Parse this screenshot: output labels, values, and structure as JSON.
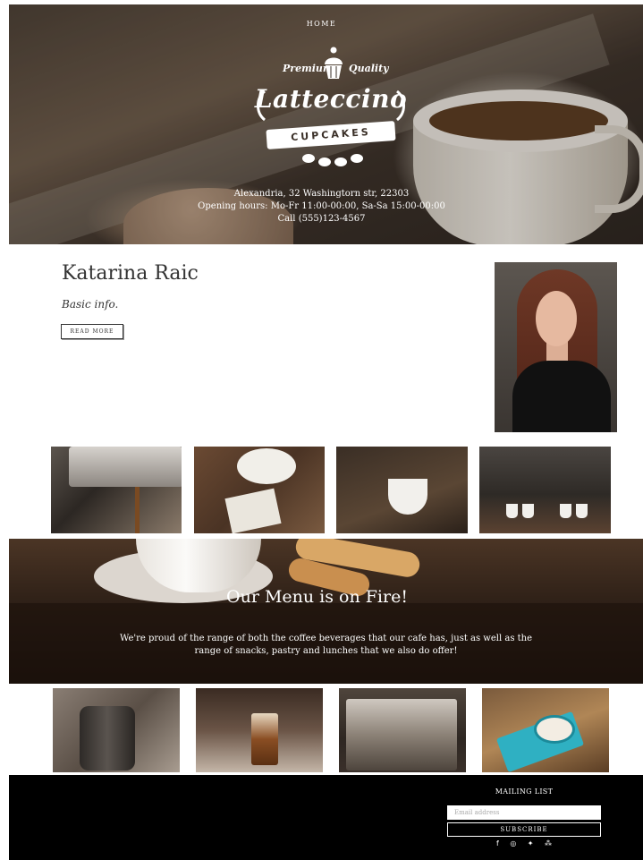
{
  "nav": {
    "home_label": "HOME"
  },
  "logo": {
    "premium_left": "Premium",
    "premium_right": "Quality",
    "brand": "Latteccino",
    "ribbon": "CUPCAKES"
  },
  "hero": {
    "address": "Alexandria, 32 Washingtorn str, 22303",
    "hours": "Opening hours: Mo-Fr 11:00-00:00, Sa-Sa 15:00-00:00",
    "phone": "Call (555)123-4567"
  },
  "profile": {
    "name": "Katarina Raic",
    "subtitle": "Basic info.",
    "read_more": "READ MORE"
  },
  "menu": {
    "title": "Our Menu is on Fire!",
    "description": "We're proud of the range of both the coffee beverages that our cafe has, just as well as the range of snacks, pastry and lunches that we also do offer!"
  },
  "footer": {
    "mailing_title": "MAILING LIST",
    "email_placeholder": "Email address",
    "subscribe_label": "SUBSCRIBE",
    "socials": [
      {
        "icon": "facebook-icon",
        "glyph": "f"
      },
      {
        "icon": "instagram-icon",
        "glyph": "◎"
      },
      {
        "icon": "twitter-icon",
        "glyph": "✦"
      },
      {
        "icon": "people-icon",
        "glyph": "⁂"
      }
    ]
  },
  "colors": {
    "footer_bg": "#000000",
    "text_dark": "#333333",
    "hero_text": "#ffffff"
  }
}
